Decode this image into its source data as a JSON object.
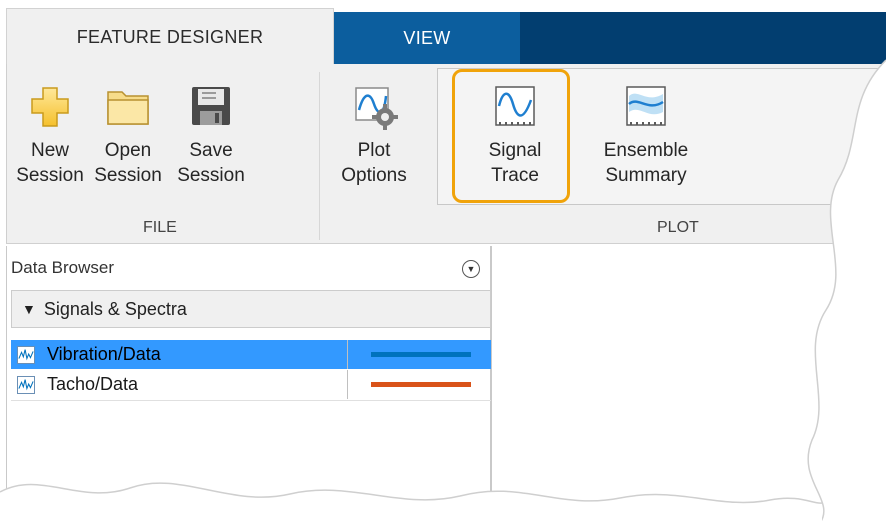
{
  "tabs": [
    {
      "label": "FEATURE DESIGNER",
      "active": true
    },
    {
      "label": "VIEW",
      "active": false
    }
  ],
  "ribbon": {
    "file": {
      "section_label": "FILE",
      "buttons": [
        {
          "line1": "New",
          "line2": "Session",
          "icon": "plus-icon"
        },
        {
          "line1": "Open",
          "line2": "Session",
          "icon": "folder-icon"
        },
        {
          "line1": "Save",
          "line2": "Session",
          "icon": "floppy-disk-icon"
        }
      ]
    },
    "plot_options": {
      "line1": "Plot",
      "line2": "Options",
      "icon": "plot-options-gear-icon"
    },
    "plot": {
      "section_label": "PLOT",
      "buttons": [
        {
          "line1": "Signal",
          "line2": "Trace",
          "icon": "signal-trace-icon"
        },
        {
          "line1": "Ensemble",
          "line2": "Summary",
          "icon": "ensemble-summary-icon"
        }
      ]
    }
  },
  "data_browser": {
    "title": "Data Browser",
    "group": "Signals & Spectra",
    "rows": [
      {
        "label": "Vibration/Data",
        "selected": true,
        "color": "#0072bd"
      },
      {
        "label": "Tacho/Data",
        "selected": false,
        "color": "#d95319"
      }
    ]
  },
  "colors": {
    "tab_blue": "#0c5e9e",
    "tab_dark": "#023e70",
    "highlight": "#f0a30a",
    "selection": "#3399ff"
  }
}
